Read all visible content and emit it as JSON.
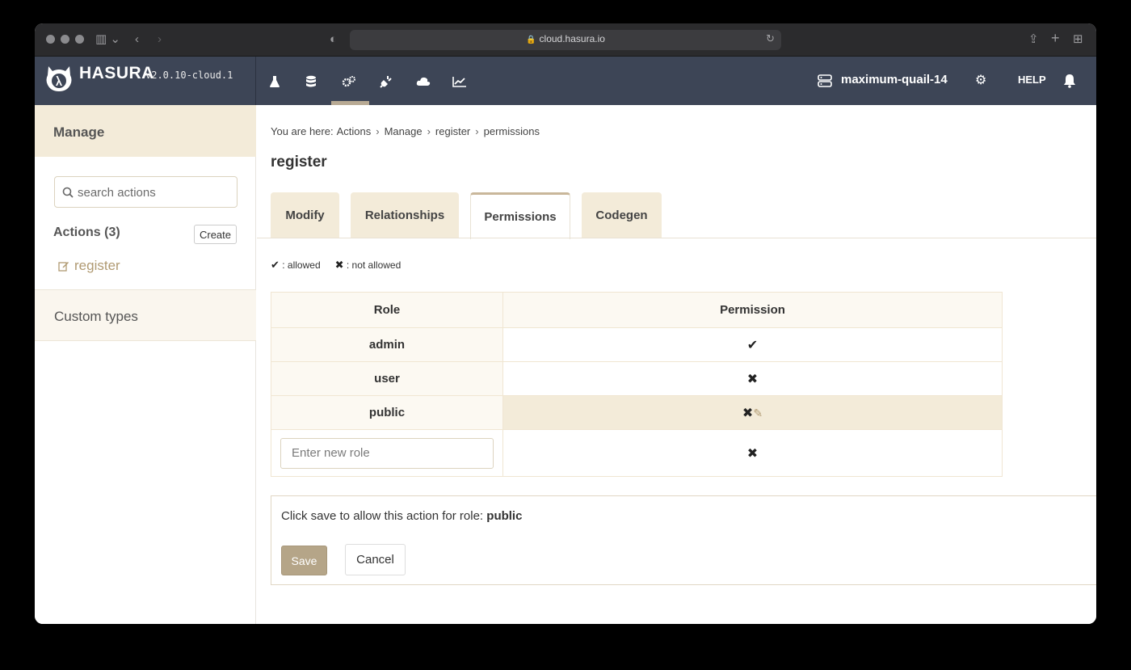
{
  "browser": {
    "url": "cloud.hasura.io"
  },
  "brand": {
    "name": "HASURA",
    "version": "v2.0.10-cloud.1"
  },
  "topnav": {
    "icons": [
      "flask-icon",
      "database-icon",
      "actions-gears-icon",
      "plug-icon",
      "cloud-icon",
      "chart-icon"
    ],
    "active_icon": "actions-gears-icon",
    "project_name": "maximum-quail-14",
    "help_label": "HELP"
  },
  "sidebar": {
    "manage_label": "Manage",
    "search_placeholder": "search actions",
    "actions_heading": "Actions (3)",
    "create_label": "Create",
    "action_item": "register",
    "custom_types_label": "Custom types"
  },
  "breadcrumb": {
    "prefix": "You are here:",
    "items": [
      "Actions",
      "Manage",
      "register",
      "permissions"
    ]
  },
  "page_title": "register",
  "tabs": [
    {
      "label": "Modify",
      "active": false
    },
    {
      "label": "Relationships",
      "active": false
    },
    {
      "label": "Permissions",
      "active": true
    },
    {
      "label": "Codegen",
      "active": false
    }
  ],
  "legend": {
    "allowed": ": allowed",
    "not_allowed": ": not allowed"
  },
  "permissions_table": {
    "headers": [
      "Role",
      "Permission"
    ],
    "rows": [
      {
        "role": "admin",
        "permission": "allowed"
      },
      {
        "role": "user",
        "permission": "not allowed"
      },
      {
        "role": "public",
        "permission": "not allowed",
        "editing": true
      }
    ],
    "new_role_placeholder": "Enter new role",
    "new_role_permission": "not allowed"
  },
  "save_panel": {
    "message": "Click save to allow this action for role:",
    "role": "public",
    "save_label": "Save",
    "cancel_label": "Cancel"
  },
  "colors": {
    "nav_bg": "#3d4556",
    "accent_beige": "#f3ebd9",
    "save_button": "#b5a588",
    "link": "#b09a72"
  }
}
